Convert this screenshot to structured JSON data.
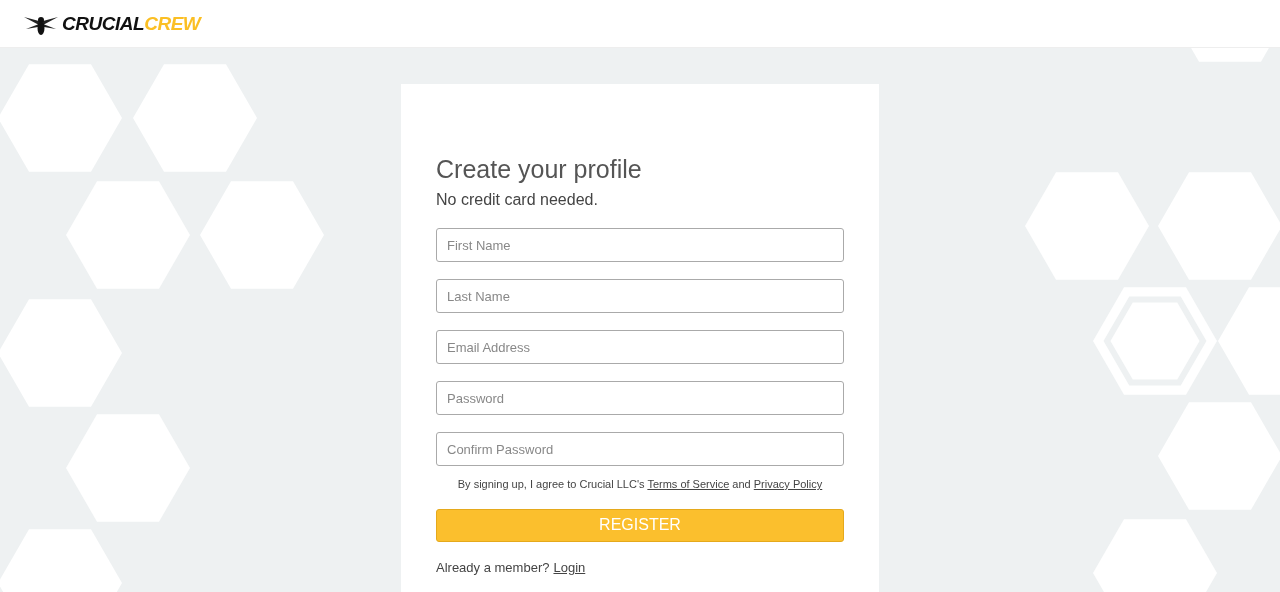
{
  "header": {
    "logo": {
      "part_1": "CRUCIAL",
      "part_2": "CREW"
    }
  },
  "form": {
    "title": "Create your profile",
    "subtitle": "No credit card needed.",
    "fields": [
      {
        "placeholder": "First Name"
      },
      {
        "placeholder": "Last Name"
      },
      {
        "placeholder": "Email Address"
      },
      {
        "placeholder": "Password"
      },
      {
        "placeholder": "Confirm Password"
      }
    ],
    "agreement": {
      "text": "By signing up, I agree to Crucial LLC's",
      "link_1": "Terms of Service",
      "joiner": "and",
      "link_2": "Privacy Policy"
    },
    "submit": "REGISTER",
    "footer": {
      "text": "Already a member?",
      "link": "Login"
    }
  }
}
